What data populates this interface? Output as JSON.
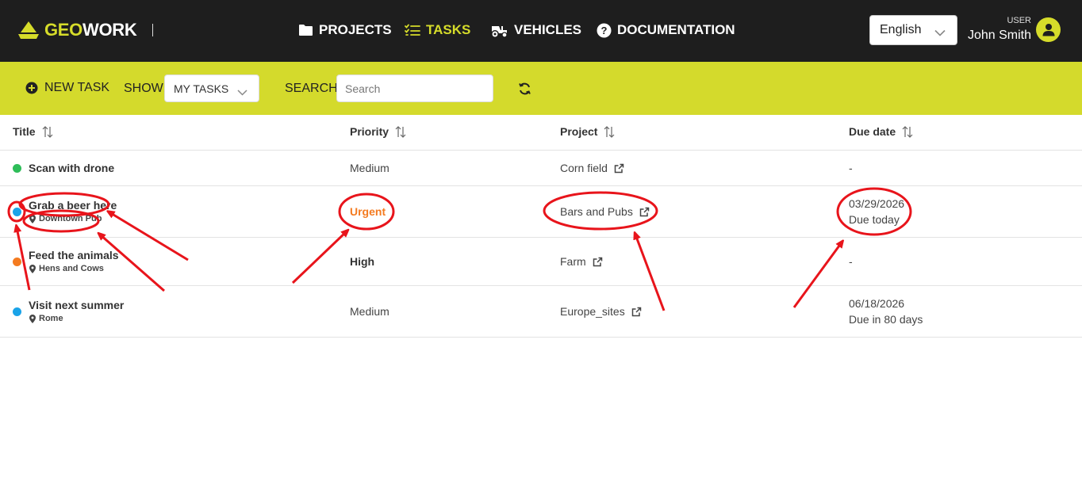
{
  "header": {
    "brand_geo": "GEO",
    "brand_work": "WORK",
    "brand_color": "#d6dc2a",
    "nav": {
      "projects": "PROJECTS",
      "tasks": "TASKS",
      "vehicles": "VEHICLES",
      "documentation": "DOCUMENTATION"
    },
    "active_nav": "tasks",
    "language": "English",
    "user_role": "USER",
    "user_name": "John Smith"
  },
  "toolbar": {
    "new_task": "NEW TASK",
    "show_label": "SHOW:",
    "show_value": "MY TASKS",
    "search_label": "SEARCH:",
    "search_placeholder": "Search",
    "search_value": ""
  },
  "table": {
    "columns": {
      "title": "Title",
      "priority": "Priority",
      "project": "Project",
      "due": "Due date"
    },
    "rows": [
      {
        "title": "Scan with drone",
        "location": "",
        "status_color": "#2ebd59",
        "priority": "Medium",
        "project": "Corn field",
        "due_date": "-",
        "due_note": ""
      },
      {
        "title": "Grab a beer here",
        "location": "Downtown Pub",
        "status_color": "#1aa3e8",
        "priority": "Urgent",
        "project": "Bars and Pubs",
        "due_date": "03/29/2026",
        "due_note": "Due today"
      },
      {
        "title": "Feed the animals",
        "location": "Hens and Cows",
        "status_color": "#f47b20",
        "priority": "High",
        "project": "Farm",
        "due_date": "-",
        "due_note": ""
      },
      {
        "title": "Visit next summer",
        "location": "Rome",
        "status_color": "#1aa3e8",
        "priority": "Medium",
        "project": "Europe_sites",
        "due_date": "06/18/2026",
        "due_note": "Due in 80 days"
      }
    ]
  },
  "annotation_color": "#e8141b"
}
